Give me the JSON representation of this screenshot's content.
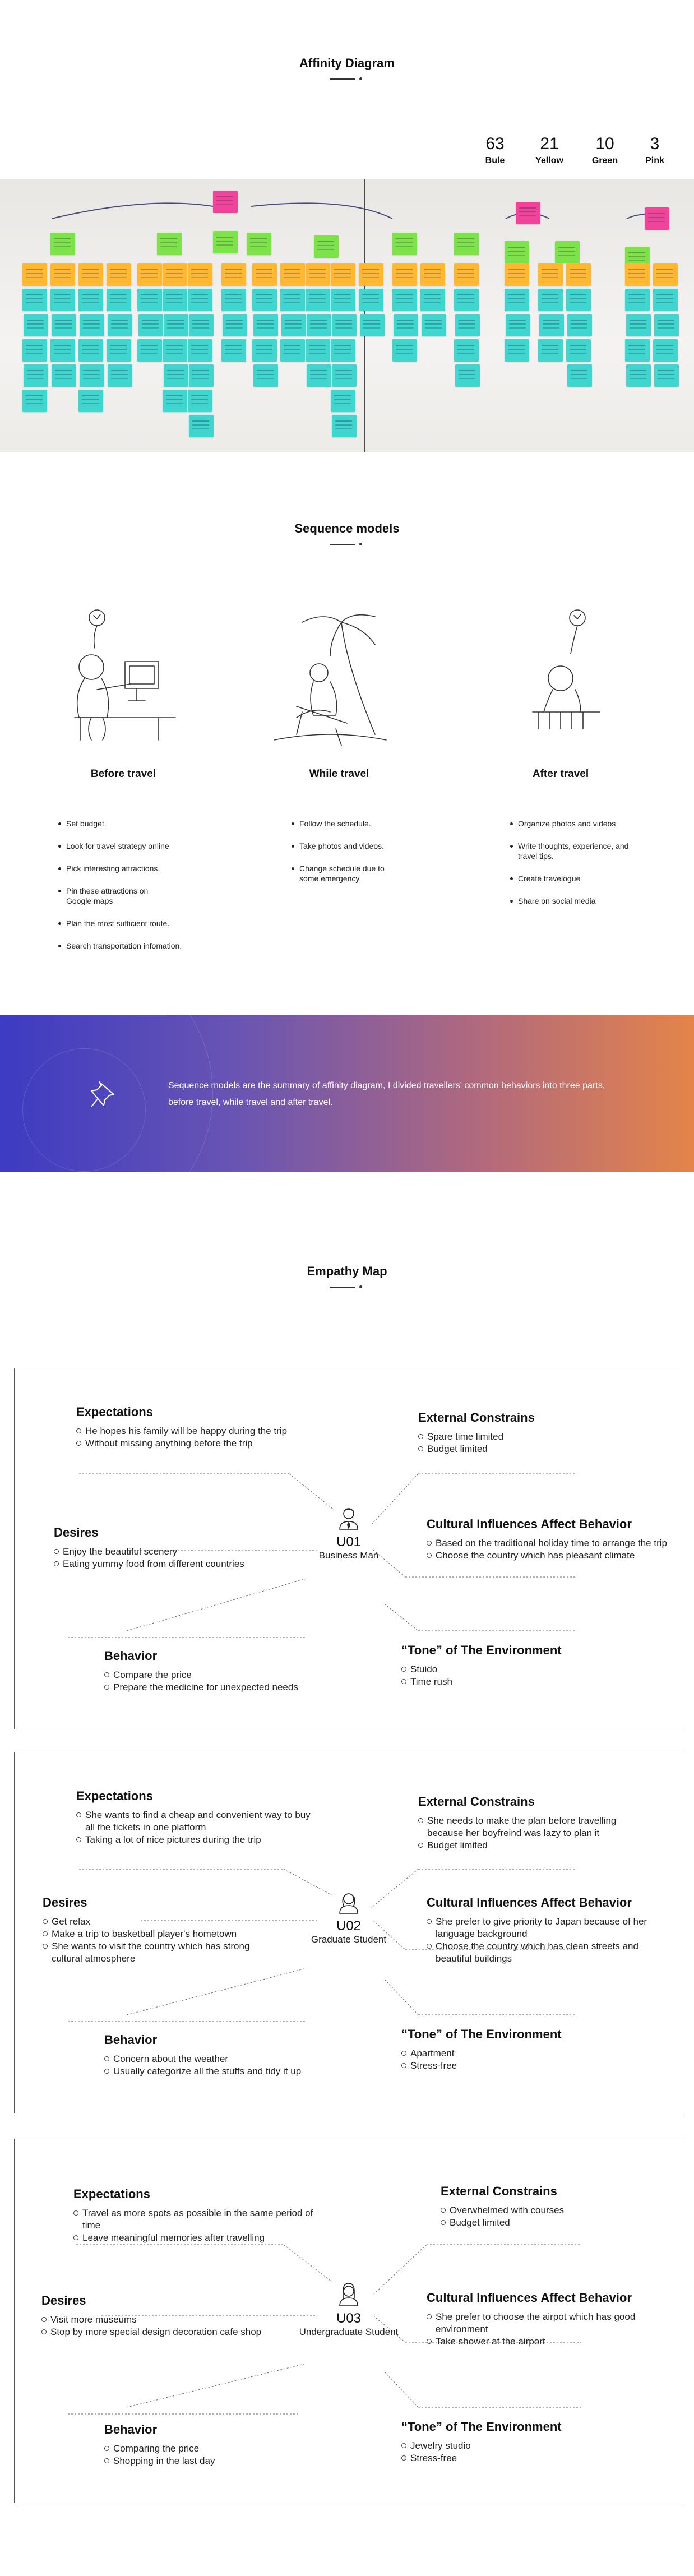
{
  "affinity": {
    "title": "Affinity Diagram",
    "counts": [
      {
        "num": "63",
        "label": "Bule"
      },
      {
        "num": "21",
        "label": "Yellow"
      },
      {
        "num": "10",
        "label": "Green"
      },
      {
        "num": "3",
        "label": "Pink"
      }
    ],
    "colors": {
      "blue": "#3fd6cf",
      "yellow": "#ffb830",
      "green": "#7ee24a",
      "pink": "#f0449a"
    }
  },
  "sequence": {
    "title": "Sequence models",
    "phases": [
      {
        "title": "Before travel",
        "items": [
          "Set budget.",
          "Look for travel strategy online",
          "Pick interesting attractions.",
          "Pin these attractions on Google maps",
          "Plan the most sufficient route.",
          "Search transportation infomation."
        ]
      },
      {
        "title": "While travel",
        "items": [
          "Follow the schedule.",
          "Take photos and videos.",
          "Change schedule due to some emergency."
        ]
      },
      {
        "title": "After travel",
        "items": [
          "Organize photos and videos",
          "Write thoughts, experience, and travel tips.",
          "Create travelogue",
          "Share on social media"
        ]
      }
    ]
  },
  "banner": {
    "text": "Sequence models are the summary of affinity diagram, I divided travellers' common behaviors into three parts, before travel, while travel and after travel.",
    "icon": "pin-icon"
  },
  "empathy": {
    "title": "Empathy Map",
    "maps": [
      {
        "code": "U01",
        "role": "Business Man",
        "expectations": {
          "title": "Expectations",
          "items": [
            "He hopes his family will be happy during the trip",
            "Without missing anything before the trip"
          ]
        },
        "constraints": {
          "title": "External Constrains",
          "items": [
            "Spare time limited",
            "Budget limited"
          ]
        },
        "desires": {
          "title": "Desires",
          "items": [
            "Enjoy the beautiful scenery",
            "Eating yummy food from different countries"
          ]
        },
        "cultural": {
          "title": "Cultural Influences Affect Behavior",
          "items": [
            "Based on the traditional holiday time to arrange the trip",
            "Choose the country which has pleasant climate"
          ]
        },
        "behavior": {
          "title": "Behavior",
          "items": [
            "Compare the price",
            "Prepare the medicine for unexpected needs"
          ]
        },
        "tone": {
          "title": "“Tone” of The Environment",
          "items": [
            "Stuido",
            "Time rush"
          ]
        }
      },
      {
        "code": "U02",
        "role": "Graduate Student",
        "expectations": {
          "title": "Expectations",
          "items": [
            "She wants to find a cheap and convenient way to buy all the tickets in one platform",
            "Taking a lot of nice pictures during the trip"
          ]
        },
        "constraints": {
          "title": "External Constrains",
          "items": [
            "She needs to make the plan before travelling because her  boyfreind was lazy to plan it",
            "Budget limited"
          ]
        },
        "desires": {
          "title": "Desires",
          "items": [
            "Get relax",
            "Make a trip to basketball player's hometown",
            "She wants to visit the country which has strong cultural atmosphere"
          ]
        },
        "cultural": {
          "title": "Cultural Influences Affect Behavior",
          "items": [
            "She prefer to give priority to Japan because of her language background",
            "Choose the country which has clean streets and beautiful buildings"
          ]
        },
        "behavior": {
          "title": "Behavior",
          "items": [
            "Concern about the weather",
            "Usually categorize all the stuffs and tidy it up"
          ]
        },
        "tone": {
          "title": "“Tone” of The Environment",
          "items": [
            "Apartment",
            "Stress-free"
          ]
        }
      },
      {
        "code": "U03",
        "role": "Undergraduate Student",
        "expectations": {
          "title": "Expectations",
          "items": [
            "Travel as more spots as possible in the same period of time",
            "Leave meaningful memories after travelling"
          ]
        },
        "constraints": {
          "title": "External Constrains",
          "items": [
            "Overwhelmed with courses",
            "Budget limited"
          ]
        },
        "desires": {
          "title": "Desires",
          "items": [
            "Visit more museums",
            "Stop by more special design decoration cafe shop"
          ]
        },
        "cultural": {
          "title": "Cultural Influences Affect Behavior",
          "items": [
            "She prefer to choose the airpot which has good environment",
            "Take shower at the airport"
          ]
        },
        "behavior": {
          "title": "Behavior",
          "items": [
            "Comparing the price",
            "Shopping in the last day"
          ]
        },
        "tone": {
          "title": "“Tone” of The Environment",
          "items": [
            "Jewelry studio",
            "Stress-free"
          ]
        }
      }
    ]
  }
}
